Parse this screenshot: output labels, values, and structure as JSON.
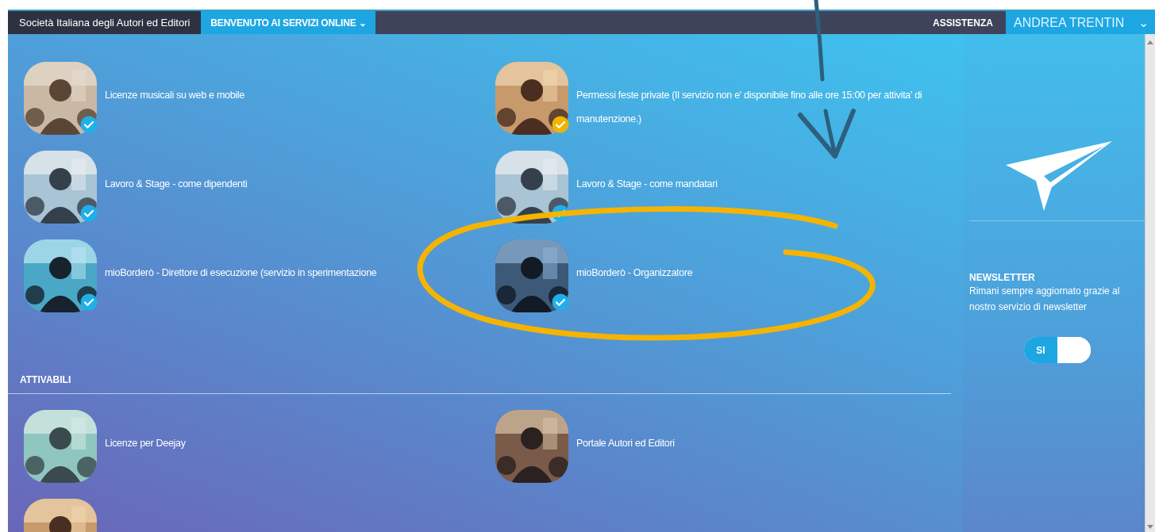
{
  "nav": {
    "brand": "Società Italiana degli Autori ed Editori",
    "menu": "BENVENUTO AI SERVIZI ONLINE",
    "caret": "⌄",
    "help": "ASSISTENZA",
    "user": "ANDREA TRENTIN",
    "user_caret": "⌄"
  },
  "active_services": [
    {
      "label": "Licenze musicali su web e mobile",
      "color": "#1fb0ea"
    },
    {
      "label": "Permessi feste private (Il servizio non e' disponibile fino alle ore 15:00 per attivita' di manutenzione.)",
      "color": "#f0b400"
    },
    {
      "label": "Lavoro & Stage - come dipendenti",
      "color": "#1fb0ea"
    },
    {
      "label": "Lavoro & Stage - come mandatari",
      "color": "#1fb0ea"
    },
    {
      "label": "mioBorderò - Direttore di esecuzione (servizio in sperimentazione",
      "color": "#1fb0ea"
    },
    {
      "label": "mioBorderò - Organizzatore",
      "color": "#1fb0ea"
    }
  ],
  "activatable_heading": "ATTIVABILI",
  "activatable_services": [
    {
      "label": "Licenze per Deejay",
      "kind": "picture"
    },
    {
      "label": "Portale Autori ed Editori",
      "kind": "picture"
    },
    {
      "kind": "picture"
    }
  ],
  "newsletter": {
    "title": "NEWSLETTER",
    "text": "Rimani sempre aggiornato grazie al nostro servizio di newsletter",
    "toggle_label": "SI",
    "on": true
  },
  "annotations": [
    {
      "kind": "arrow",
      "color": "#2d5f7e"
    },
    {
      "kind": "ellipse",
      "color": "#f5b400"
    }
  ]
}
